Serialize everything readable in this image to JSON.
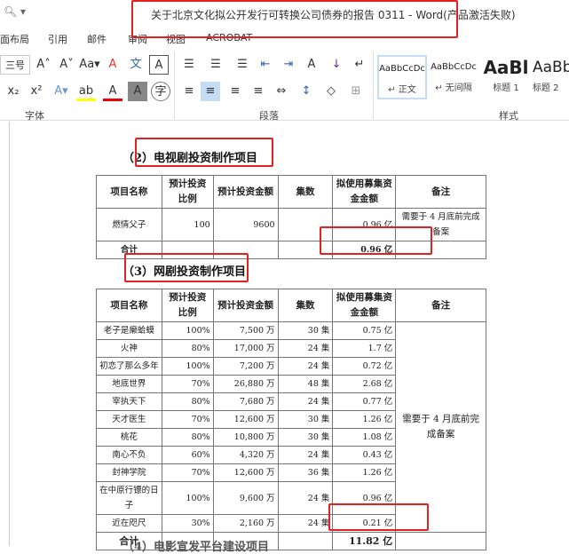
{
  "window": {
    "title": "关于北京文化拟公开发行可转换公司债券的报告 0311 - Word(产品激活失败)"
  },
  "tabs": [
    "面布局",
    "引用",
    "邮件",
    "审阅",
    "视图",
    "ACROBAT"
  ],
  "ribbon": {
    "font_size": "三号",
    "groups": [
      "字体",
      "段落",
      "样式"
    ],
    "styles": [
      {
        "preview": "AaBbCcDc",
        "label": "↵ 正文"
      },
      {
        "preview": "AaBbCcDc",
        "label": "↵ 无间隔"
      },
      {
        "preview": "AaBl",
        "label": "标题 1"
      },
      {
        "preview": "AaBbC",
        "label": "标题 2"
      }
    ]
  },
  "doc": {
    "heading2": "（2）电视剧投资制作项目",
    "heading3": "（3）网剧投资制作项目",
    "heading4": "（4）电影宣发平台建设项目",
    "columns": [
      "项目名称",
      "预计投资比例",
      "预计投资金额",
      "集数",
      "拟使用募集资金金额",
      "备注"
    ],
    "table1": {
      "rows": [
        [
          "燃情父子",
          "100",
          "9600",
          "",
          "0.96 亿"
        ]
      ],
      "note": "需要于 4 月底前完成备案",
      "total_label": "合计",
      "total": "0.96 亿"
    },
    "table2": {
      "rows": [
        [
          "老子是癞蛤蟆",
          "100%",
          "7,500 万",
          "30 集",
          "0.75 亿"
        ],
        [
          "火神",
          "80%",
          "17,000 万",
          "24 集",
          "1.7 亿"
        ],
        [
          "初恋了那么多年",
          "100%",
          "7,200 万",
          "24 集",
          "0.72 亿"
        ],
        [
          "地底世界",
          "70%",
          "26,880 万",
          "48 集",
          "2.68 亿"
        ],
        [
          "宰执天下",
          "80%",
          "7,680 万",
          "24 集",
          "0.77 亿"
        ],
        [
          "天才医生",
          "70%",
          "12,600 万",
          "30 集",
          "1.26 亿"
        ],
        [
          "桃花",
          "80%",
          "10,800 万",
          "30 集",
          "1.08 亿"
        ],
        [
          "南心不负",
          "60%",
          "4,320 万",
          "24 集",
          "0.43 亿"
        ],
        [
          "封神学院",
          "70%",
          "12,600 万",
          "36 集",
          "1.26 亿"
        ],
        [
          "在中原行镖的日子",
          "100%",
          "9,600 万",
          "24 集",
          "0.96 亿"
        ],
        [
          "近在咫尺",
          "30%",
          "2,160 万",
          "24 集",
          "0.21 亿"
        ]
      ],
      "note": "需要于 4 月底前完成备案",
      "total_label": "合计",
      "total": "11.82 亿"
    }
  },
  "colors": {
    "highlight": "#e52020"
  }
}
